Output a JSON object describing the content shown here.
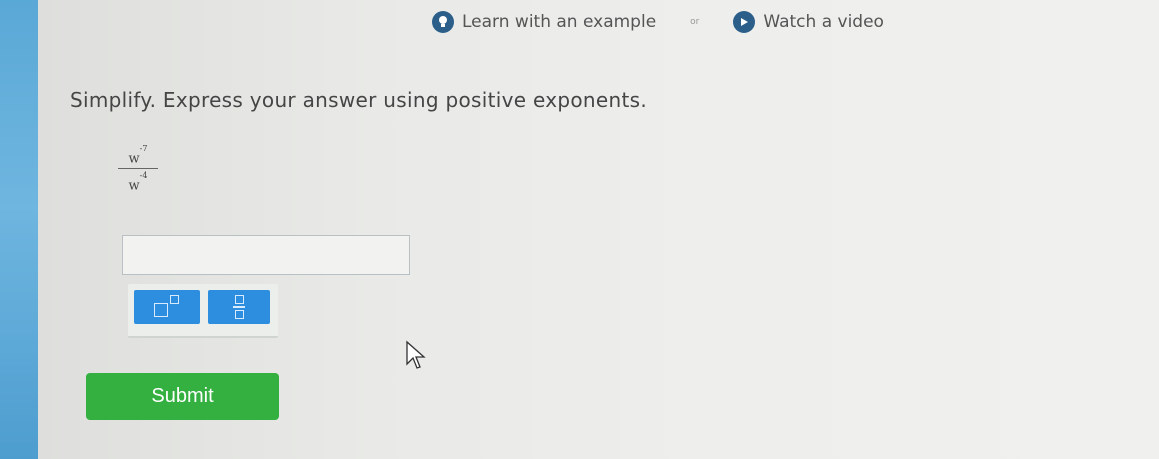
{
  "help": {
    "learn_label": "Learn with an example",
    "learn_icon": "lightbulb-icon",
    "or_label": "or",
    "video_label": "Watch a video",
    "video_icon": "play-icon"
  },
  "question": {
    "instruction": "Simplify. Express your answer using positive exponents.",
    "numerator_base": "w",
    "numerator_exponent": "-7",
    "denominator_base": "w",
    "denominator_exponent": "-4"
  },
  "answer": {
    "value": ""
  },
  "toolbar": {
    "exponent_icon": "exponent-template-icon",
    "fraction_icon": "fraction-template-icon"
  },
  "submit_label": "Submit",
  "colors": {
    "left_strip": "#5aa8d6",
    "tool_button": "#2d8ee0",
    "submit_button": "#33b040",
    "help_icon": "#2b5f8a"
  }
}
